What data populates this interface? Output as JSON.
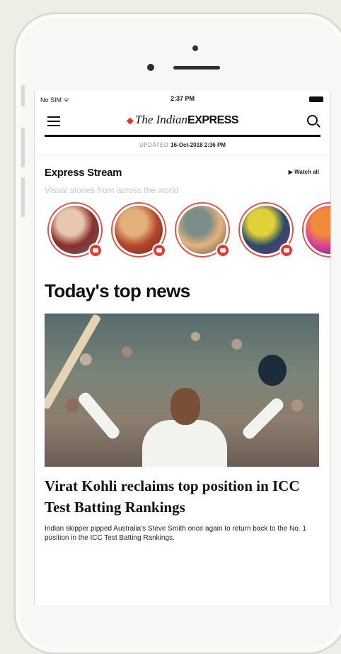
{
  "status_bar": {
    "carrier": "No SIM ᯤ",
    "time": "2:37 PM"
  },
  "header": {
    "logo_the": "The Indian",
    "logo_express": "EXPRESS",
    "updated_label": "UPDATED",
    "updated_value": "16-Oct-2018 2:36 PM"
  },
  "stream": {
    "title": "Express Stream",
    "watch_all": "▶ Watch all",
    "subtitle": "Visual stories from across the world",
    "stories": [
      {
        "name": "story-1",
        "colors": [
          "#8a2d2a",
          "#e8c6b0",
          "#5a6d7a"
        ]
      },
      {
        "name": "story-2",
        "colors": [
          "#b4472c",
          "#e2b07a",
          "#6e2a1f"
        ]
      },
      {
        "name": "story-3",
        "colors": [
          "#e5b27d",
          "#7d8d89",
          "#3f5a49"
        ]
      },
      {
        "name": "story-4",
        "colors": [
          "#2a4a6a",
          "#e2d03a",
          "#8e2f6a"
        ]
      },
      {
        "name": "story-5",
        "colors": [
          "#d9419a",
          "#f08a3c",
          "#5a2a4a"
        ]
      }
    ]
  },
  "top_news": {
    "section_title": "Today's top news",
    "headline": "Virat Kohli reclaims top position in ICC Test Batting Rankings",
    "summary": "Indian skipper pipped Australia's Steve Smith once again to return back to the No. 1 position in the ICC Test Batting Rankings."
  },
  "colors": {
    "brand_red": "#e2322b",
    "story_ring": "#e0524a",
    "badge": "#e23b30"
  }
}
